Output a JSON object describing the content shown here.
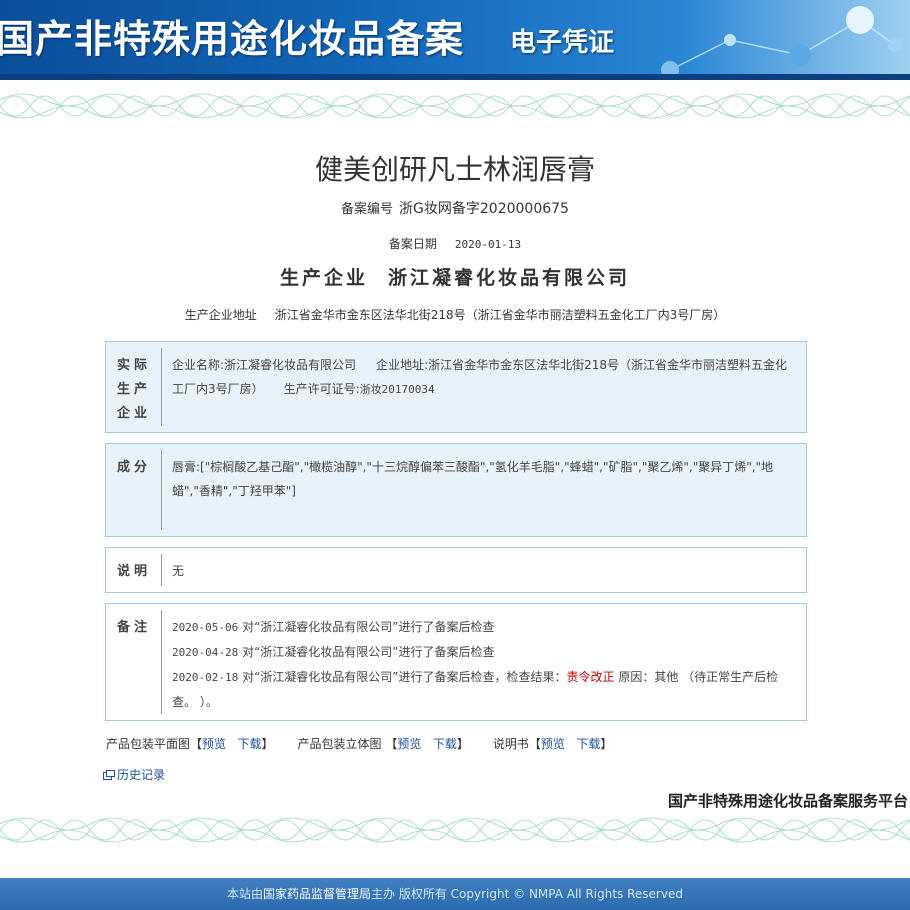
{
  "banner": {
    "title": "国产非特殊用途化妆品备案",
    "subtitle": "电子凭证"
  },
  "product": {
    "name": "健美创研凡士林润唇膏",
    "reg_label": "备案编号",
    "reg_no": "浙G妆网备字2020000675",
    "date_label": "备案日期",
    "date": "2020-01-13",
    "company_label": "生产企业",
    "company": "浙江凝睿化妆品有限公司",
    "address_label": "生产企业地址",
    "address": "浙江省金华市金东区法华北街218号（浙江省金华市丽洁塑料五金化工厂内3号厂房）"
  },
  "actual_producer": {
    "label": "实际生产企业",
    "label_lines": [
      "实际",
      "生产",
      "企业"
    ],
    "name_label": "企业名称:",
    "name": "浙江凝睿化妆品有限公司",
    "address_label": "企业地址:",
    "address": "浙江省金华市金东区法华北街218号（浙江省金华市丽洁塑料五金化工厂内3号厂房）",
    "license_label": "生产许可证号:",
    "license": "浙妆20170034"
  },
  "ingredients": {
    "label": "成分",
    "text": "唇膏:[\"棕榈酸乙基己酯\",\"橄榄油醇\",\"十三烷醇偏苯三酸酯\",\"氢化羊毛脂\",\"蜂蜡\",\"矿脂\",\"聚乙烯\",\"聚异丁烯\",\"地蜡\",\"香精\",\"丁羟甲苯\"]"
  },
  "description": {
    "label": "说明",
    "text": "无"
  },
  "remarks": {
    "label": "备注",
    "items": [
      {
        "date": "2020-05-06",
        "text": "对“浙江凝睿化妆品有限公司”进行了备案后检查"
      },
      {
        "date": "2020-04-28",
        "text": "对“浙江凝睿化妆品有限公司”进行了备案后检查"
      },
      {
        "date": "2020-02-18",
        "text": "对“浙江凝睿化妆品有限公司”进行了备案后检查，检查结果：",
        "result": "责令改正",
        "reason": "原因：其他 （待正常生产后检查。 ）。"
      }
    ]
  },
  "downloads": {
    "flat_label": "产品包装平面图",
    "solid_label": "产品包装立体图",
    "manual_label": "说明书",
    "preview": "预览",
    "download": "下载",
    "open_bracket": "【",
    "close_bracket": "】"
  },
  "history_label": "历史记录",
  "platform_label": "国产非特殊用途化妆品备案服务平台",
  "footer": {
    "prefix": "本站由",
    "org": "国家药品监督管理局",
    "suffix": "主办 版权所有 Copyright © NMPA All Rights Reserved"
  },
  "colors": {
    "banner_blue": "#1366b8",
    "box_bg": "#e7f2fb",
    "box_border": "#a9c7e0",
    "link": "#1a4e9b",
    "warning_red": "#c40000",
    "footer_blue": "#3f80c2"
  }
}
